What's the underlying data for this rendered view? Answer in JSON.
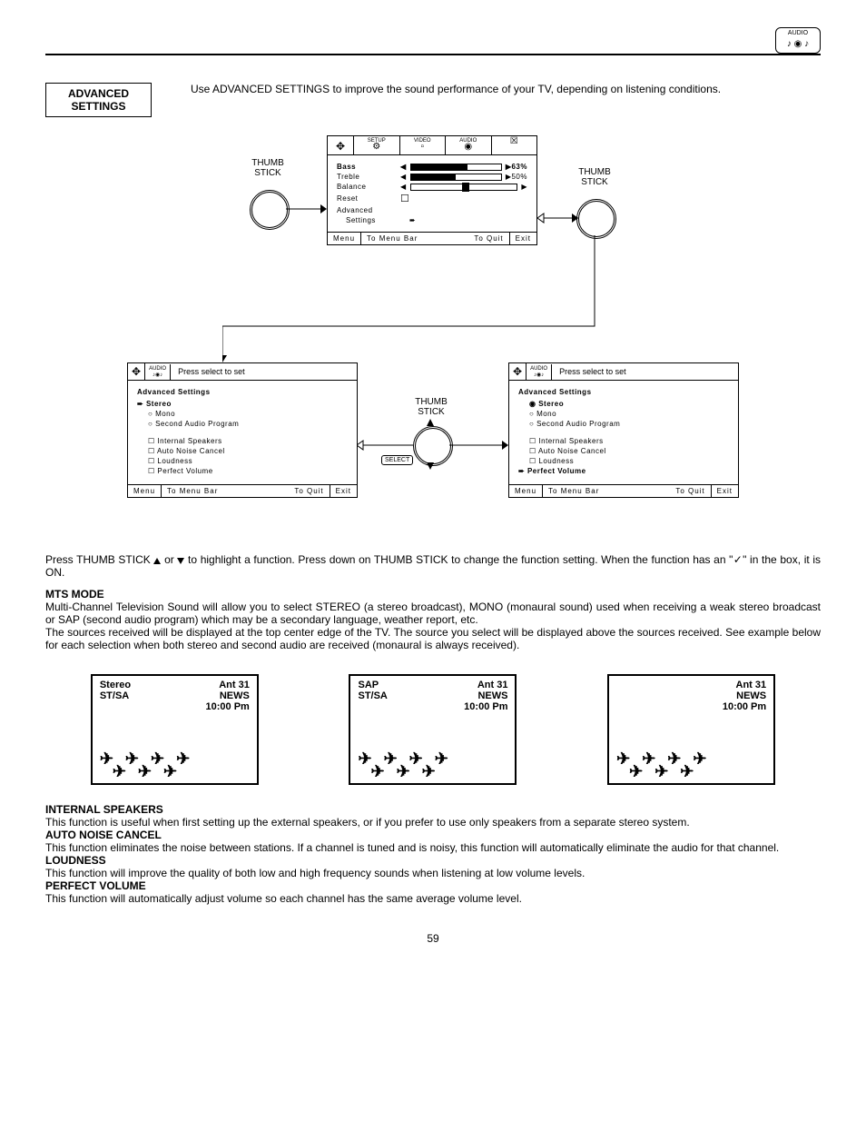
{
  "header_icon": "AUDIO",
  "section_box": "ADVANCED SETTINGS",
  "intro": "Use ADVANCED SETTINGS to improve the sound performance of your TV, depending on listening conditions.",
  "thumb_label": "THUMB STICK",
  "select_label": "SELECT",
  "osd_main": {
    "tabs": [
      "SETUP",
      "VIDEO",
      "AUDIO",
      ""
    ],
    "rows": [
      {
        "label": "Bass",
        "val": "63%",
        "fill": 63,
        "bold": true
      },
      {
        "label": "Treble",
        "val": "50%",
        "fill": 50
      },
      {
        "label": "Balance",
        "val": "",
        "fill": 50,
        "balance": true
      },
      {
        "label": "Reset",
        "box": true
      },
      {
        "label": "Advanced",
        "sub": "Settings",
        "arrow": true
      }
    ],
    "footer_left": "Menu",
    "footer_mid": "To Menu Bar",
    "footer_rlabel": "To Quit",
    "footer_right": "Exit"
  },
  "osd_adv_header": "Press select to set",
  "adv_heading": "Advanced Settings",
  "adv_left": {
    "radios": [
      {
        "label": "Stereo",
        "on": true,
        "sel": true
      },
      {
        "label": "Mono"
      },
      {
        "label": "Second Audio Program"
      }
    ],
    "checks": [
      "Internal Speakers",
      "Auto Noise Cancel",
      "Loudness",
      "Perfect Volume"
    ]
  },
  "adv_right": {
    "radios": [
      {
        "label": "Stereo",
        "on": true
      },
      {
        "label": "Mono"
      },
      {
        "label": "Second Audio Program"
      }
    ],
    "checks": [
      "Internal Speakers",
      "Auto Noise Cancel",
      "Loudness"
    ],
    "checks_sel": {
      "label": "Perfect Volume",
      "sel": true
    }
  },
  "instruction": {
    "pre": "Press THUMB STICK ",
    "mid": " or ",
    "post": " to highlight a function. Press down on THUMB STICK to change the function setting. When the function has an \"✓\" in the box, it is ON."
  },
  "mts": {
    "title": "MTS MODE",
    "p1": "Multi-Channel Television Sound will allow you to select STEREO (a stereo broadcast), MONO (monaural sound) used when receiving a weak stereo broadcast or SAP (second audio program) which may be a secondary language, weather report, etc.",
    "p2": "The sources received will be displayed at the top center edge of the TV.  The source you select will be displayed above the sources received.  See example below for each selection when both stereo and second audio are received (monaural is always received)."
  },
  "examples": [
    {
      "tl": "Stereo",
      "tr": "Ant    31",
      "l2": "ST/SA",
      "r2": "NEWS",
      "r3": "10:00 Pm"
    },
    {
      "tl": "SAP",
      "tr": "Ant    31",
      "l2": "ST/SA",
      "r2": "NEWS",
      "r3": "10:00 Pm"
    },
    {
      "tl": "",
      "tr": "Ant    31",
      "l2": "",
      "r2": "NEWS",
      "r3": "10:00 Pm"
    }
  ],
  "sections": [
    {
      "title": "INTERNAL SPEAKERS",
      "body": "This function is useful when first setting up the external speakers, or if you prefer to use only speakers from a separate stereo system."
    },
    {
      "title": "AUTO NOISE CANCEL",
      "body": "This function eliminates the noise between stations. If a channel is tuned and is noisy, this function will automatically eliminate the audio for that channel."
    },
    {
      "title": "LOUDNESS",
      "body": "This function will improve the quality of both low and high frequency sounds when listening at low volume levels."
    },
    {
      "title": "PERFECT VOLUME",
      "body": "This function will automatically adjust volume so each channel has the same average volume level."
    }
  ],
  "page": "59"
}
